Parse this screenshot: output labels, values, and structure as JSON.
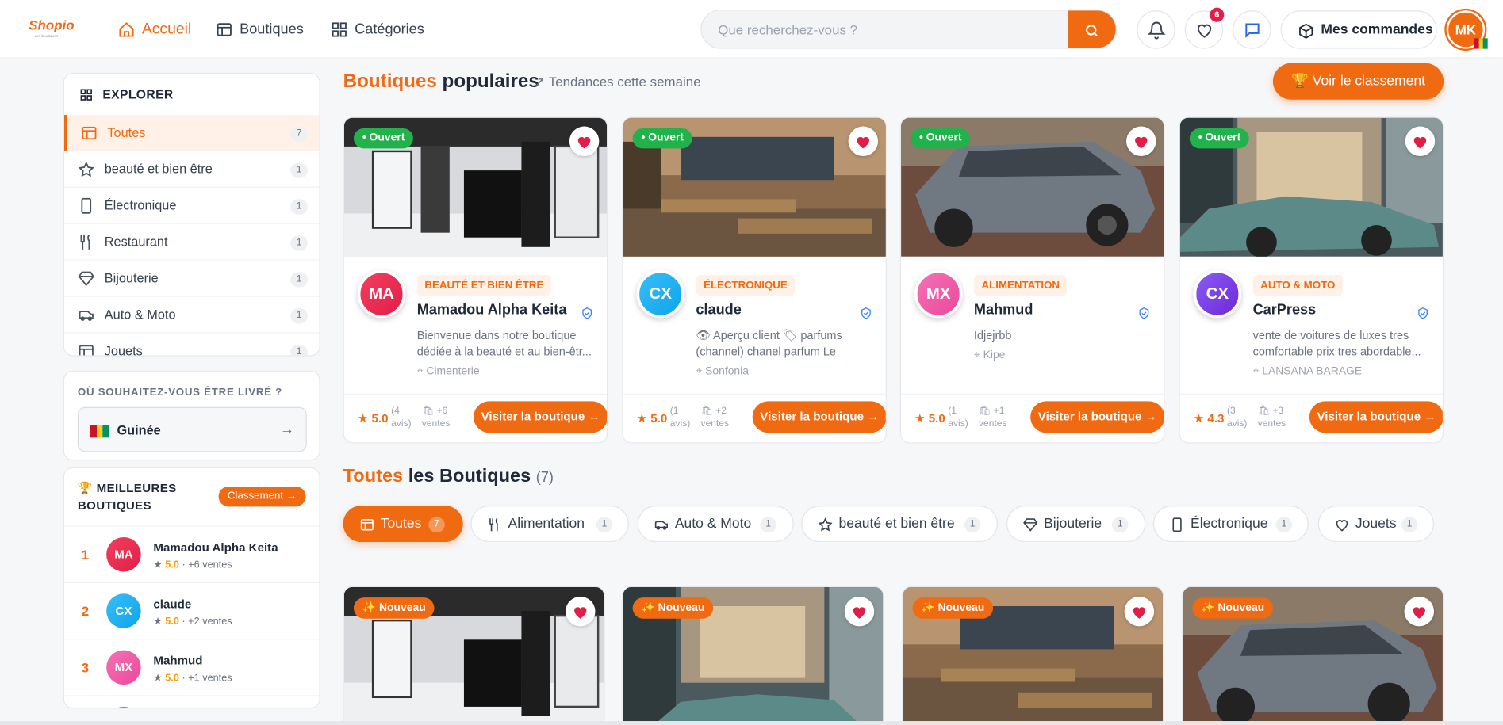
{
  "header": {
    "logo": "Shopio",
    "logo_tagline": "vos boutiques",
    "nav": [
      {
        "label": "Accueil",
        "icon": "home-icon",
        "active": true
      },
      {
        "label": "Boutiques",
        "icon": "store-icon",
        "active": false
      },
      {
        "label": "Catégories",
        "icon": "grid-icon",
        "active": false
      }
    ],
    "search_placeholder": "Que recherchez-vous ?",
    "favorites_count": "6",
    "orders_label": "Mes commandes",
    "avatar_initials": "MK"
  },
  "sidebar": {
    "explore_title": "EXPLORER",
    "categories": [
      {
        "label": "Toutes",
        "count": "7",
        "icon": "store-icon",
        "active": true
      },
      {
        "label": "beauté et bien être",
        "count": "1",
        "icon": "star-icon"
      },
      {
        "label": "Électronique",
        "count": "1",
        "icon": "phone-icon"
      },
      {
        "label": "Restaurant",
        "count": "1",
        "icon": "utensils-icon"
      },
      {
        "label": "Bijouterie",
        "count": "1",
        "icon": "diamond-icon"
      },
      {
        "label": "Auto & Moto",
        "count": "1",
        "icon": "car-icon"
      },
      {
        "label": "Jouets",
        "count": "1",
        "icon": "toy-icon"
      }
    ],
    "delivery_title": "OÙ SOUHAITEZ-VOUS ÊTRE LIVRÉ ?",
    "delivery_country": "Guinée",
    "delivery_arrow": "→",
    "best_title": "🏆 MEILLEURES BOUTIQUES",
    "best_button": "Classement →",
    "best": [
      {
        "rank": "1",
        "initials": "MA",
        "name": "Mamadou Alpha Keita",
        "rating": "5.0",
        "sales": "· +6 ventes"
      },
      {
        "rank": "2",
        "initials": "CX",
        "name": "claude",
        "rating": "5.0",
        "sales": "· +2 ventes"
      },
      {
        "rank": "3",
        "initials": "MX",
        "name": "Mahmud",
        "rating": "5.0",
        "sales": "· +1 ventes"
      }
    ]
  },
  "popular": {
    "title_accent": "Boutiques",
    "title_rest": "populaires",
    "trend": "Tendances cette semaine",
    "ranking_button": "🏆 Voir le classement",
    "shops": [
      {
        "status": "• Ouvert",
        "initials": "MA",
        "category": "BEAUTÉ ET BIEN ÊTRE",
        "name": "Mamadou Alpha Keita",
        "desc": "Bienvenue dans notre boutique dédiée à la beauté et au bien-êtr...",
        "location": "Cimenterie",
        "rating": "5.0",
        "reviews": "(4 avis)",
        "sales": "+6 ventes",
        "visit": "Visiter la boutique →"
      },
      {
        "status": "• Ouvert",
        "initials": "CX",
        "category": "ÉLECTRONIQUE",
        "name": "claude",
        "desc": "👁 Aperçu client 🏷 parfums (channel) chanel parfum Le parfu...",
        "location": "Sonfonia",
        "rating": "5.0",
        "reviews": "(1 avis)",
        "sales": "+2 ventes",
        "visit": "Visiter la boutique →"
      },
      {
        "status": "• Ouvert",
        "initials": "MX",
        "category": "ALIMENTATION",
        "name": "Mahmud",
        "desc": "Idjejrbb",
        "location": "Kipe",
        "rating": "5.0",
        "reviews": "(1 avis)",
        "sales": "+1 ventes",
        "visit": "Visiter la boutique →"
      },
      {
        "status": "• Ouvert",
        "initials": "CX",
        "category": "AUTO & MOTO",
        "name": "CarPress",
        "desc": "vente de voitures de luxes tres comfortable prix tres abordable...",
        "location": "LANSANA BARAGE",
        "rating": "4.3",
        "reviews": "(3 avis)",
        "sales": "+3 ventes",
        "visit": "Visiter la boutique →"
      }
    ]
  },
  "all": {
    "title_accent": "Toutes",
    "title_rest": "les Boutiques",
    "count": "(7)",
    "filters": [
      {
        "label": "Toutes",
        "count": "7",
        "icon": "store-icon",
        "active": true
      },
      {
        "label": "Alimentation",
        "count": "1",
        "icon": "utensils-icon"
      },
      {
        "label": "Auto & Moto",
        "count": "1",
        "icon": "car-icon"
      },
      {
        "label": "beauté et bien être",
        "count": "1",
        "icon": "star-icon"
      },
      {
        "label": "Bijouterie",
        "count": "1",
        "icon": "diamond-icon"
      },
      {
        "label": "Électronique",
        "count": "1",
        "icon": "phone-icon"
      },
      {
        "label": "Jouets",
        "count": "1",
        "icon": "heart-icon"
      }
    ],
    "badge": "✨ Nouveau"
  },
  "colors": {
    "accent": "#f06a12",
    "open": "#22b24c",
    "favorite": "#e11d48"
  }
}
